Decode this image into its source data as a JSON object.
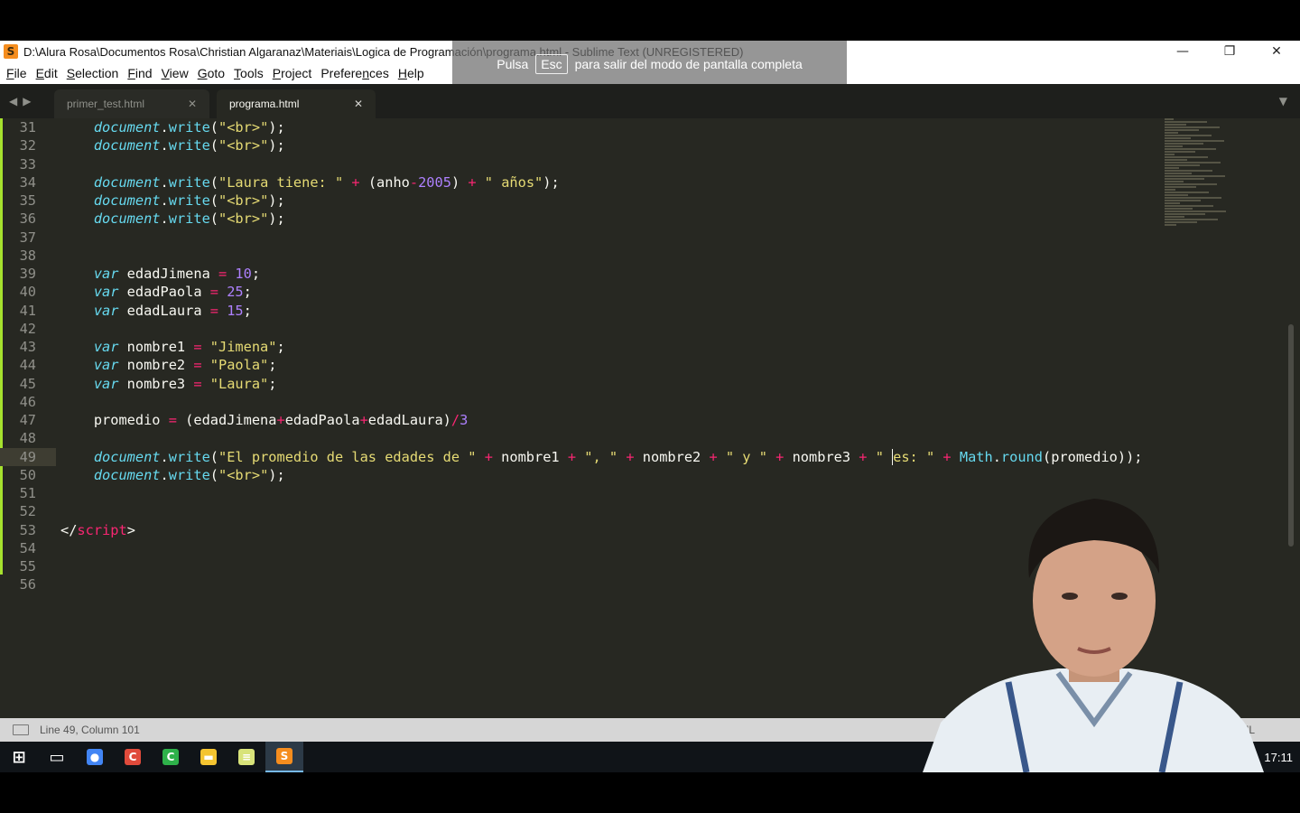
{
  "window": {
    "title": "D:\\Alura Rosa\\Documentos Rosa\\Christian Algaranaz\\Materiais\\Logica de Programación\\programa.html - Sublime Text (UNREGISTERED)",
    "minimize": "—",
    "maximize": "❐",
    "close": "✕"
  },
  "menu": [
    {
      "u": "F",
      "rest": "ile"
    },
    {
      "u": "E",
      "rest": "dit"
    },
    {
      "u": "S",
      "rest": "election"
    },
    {
      "u": "F",
      "rest": "ind",
      "pre": ""
    },
    {
      "u": "V",
      "rest": "iew"
    },
    {
      "u": "G",
      "rest": "oto"
    },
    {
      "u": "T",
      "rest": "ools"
    },
    {
      "u": "P",
      "rest": "roject"
    },
    {
      "pre": "Prefere",
      "u": "n",
      "rest": "ces"
    },
    {
      "u": "H",
      "rest": "elp"
    }
  ],
  "fullscreen_hint": {
    "before": "Pulsa",
    "key": "Esc",
    "after": "para salir del modo de pantalla completa"
  },
  "tabs": {
    "inactive": "primer_test.html",
    "active": "programa.html",
    "close": "✕",
    "dropdown": "▼",
    "nav_left": "◀",
    "nav_right": "▶"
  },
  "editor": {
    "current_line": 49,
    "lines": [
      {
        "n": "31",
        "tokens": [
          [
            "kw",
            "    document"
          ],
          [
            "",
            "."
          ],
          [
            "fn",
            "write"
          ],
          [
            "",
            "("
          ],
          [
            "str",
            "\"<br>\""
          ],
          [
            "",
            ");"
          ]
        ]
      },
      {
        "n": "32",
        "tokens": [
          [
            "kw",
            "    document"
          ],
          [
            "",
            "."
          ],
          [
            "fn",
            "write"
          ],
          [
            "",
            "("
          ],
          [
            "str",
            "\"<br>\""
          ],
          [
            "",
            ");"
          ]
        ]
      },
      {
        "n": "33",
        "tokens": []
      },
      {
        "n": "34",
        "tokens": [
          [
            "kw",
            "    document"
          ],
          [
            "",
            "."
          ],
          [
            "fn",
            "write"
          ],
          [
            "",
            "("
          ],
          [
            "str",
            "\"Laura tiene: \""
          ],
          [
            "",
            " "
          ],
          [
            "op",
            "+"
          ],
          [
            "",
            " (anho"
          ],
          [
            "op",
            "-"
          ],
          [
            "num",
            "2005"
          ],
          [
            "",
            ") "
          ],
          [
            "op",
            "+"
          ],
          [
            "",
            " "
          ],
          [
            "str",
            "\" años\""
          ],
          [
            "",
            ");"
          ]
        ]
      },
      {
        "n": "35",
        "tokens": [
          [
            "kw",
            "    document"
          ],
          [
            "",
            "."
          ],
          [
            "fn",
            "write"
          ],
          [
            "",
            "("
          ],
          [
            "str",
            "\"<br>\""
          ],
          [
            "",
            ");"
          ]
        ]
      },
      {
        "n": "36",
        "tokens": [
          [
            "kw",
            "    document"
          ],
          [
            "",
            "."
          ],
          [
            "fn",
            "write"
          ],
          [
            "",
            "("
          ],
          [
            "str",
            "\"<br>\""
          ],
          [
            "",
            ");"
          ]
        ]
      },
      {
        "n": "37",
        "tokens": []
      },
      {
        "n": "38",
        "tokens": []
      },
      {
        "n": "39",
        "tokens": [
          [
            "kw",
            "    var"
          ],
          [
            "",
            " edadJimena "
          ],
          [
            "op",
            "="
          ],
          [
            "",
            " "
          ],
          [
            "num",
            "10"
          ],
          [
            "",
            ";"
          ]
        ]
      },
      {
        "n": "40",
        "tokens": [
          [
            "kw",
            "    var"
          ],
          [
            "",
            " edadPaola "
          ],
          [
            "op",
            "="
          ],
          [
            "",
            " "
          ],
          [
            "num",
            "25"
          ],
          [
            "",
            ";"
          ]
        ]
      },
      {
        "n": "41",
        "tokens": [
          [
            "kw",
            "    var"
          ],
          [
            "",
            " edadLaura "
          ],
          [
            "op",
            "="
          ],
          [
            "",
            " "
          ],
          [
            "num",
            "15"
          ],
          [
            "",
            ";"
          ]
        ]
      },
      {
        "n": "42",
        "tokens": []
      },
      {
        "n": "43",
        "tokens": [
          [
            "kw",
            "    var"
          ],
          [
            "",
            " nombre1 "
          ],
          [
            "op",
            "="
          ],
          [
            "",
            " "
          ],
          [
            "str",
            "\"Jimena\""
          ],
          [
            "",
            ";"
          ]
        ]
      },
      {
        "n": "44",
        "tokens": [
          [
            "kw",
            "    var"
          ],
          [
            "",
            " nombre2 "
          ],
          [
            "op",
            "="
          ],
          [
            "",
            " "
          ],
          [
            "str",
            "\"Paola\""
          ],
          [
            "",
            ";"
          ]
        ]
      },
      {
        "n": "45",
        "tokens": [
          [
            "kw",
            "    var"
          ],
          [
            "",
            " nombre3 "
          ],
          [
            "op",
            "="
          ],
          [
            "",
            " "
          ],
          [
            "str",
            "\"Laura\""
          ],
          [
            "",
            ";"
          ]
        ]
      },
      {
        "n": "46",
        "tokens": []
      },
      {
        "n": "47",
        "tokens": [
          [
            "",
            "    promedio "
          ],
          [
            "op",
            "="
          ],
          [
            "",
            " (edadJimena"
          ],
          [
            "op",
            "+"
          ],
          [
            "",
            "edadPaola"
          ],
          [
            "op",
            "+"
          ],
          [
            "",
            "edadLaura)"
          ],
          [
            "op",
            "/"
          ],
          [
            "num",
            "3"
          ]
        ]
      },
      {
        "n": "48",
        "tokens": []
      },
      {
        "n": "49",
        "tokens": [
          [
            "kw",
            "    document"
          ],
          [
            "",
            "."
          ],
          [
            "fn",
            "write"
          ],
          [
            "",
            "("
          ],
          [
            "str",
            "\"El promedio de las edades de \""
          ],
          [
            "",
            " "
          ],
          [
            "op",
            "+"
          ],
          [
            "",
            " nombre1 "
          ],
          [
            "op",
            "+"
          ],
          [
            "",
            " "
          ],
          [
            "str",
            "\", \""
          ],
          [
            "",
            " "
          ],
          [
            "op",
            "+"
          ],
          [
            "",
            " nombre2 "
          ],
          [
            "op",
            "+"
          ],
          [
            "",
            " "
          ],
          [
            "str",
            "\" y \""
          ],
          [
            "",
            " "
          ],
          [
            "op",
            "+"
          ],
          [
            "",
            " nombre3 "
          ],
          [
            "op",
            "+"
          ],
          [
            "",
            " "
          ],
          [
            "str",
            "\" "
          ],
          [
            "cursor",
            ""
          ],
          [
            "str",
            "es: \""
          ],
          [
            "",
            " "
          ],
          [
            "op",
            "+"
          ],
          [
            "",
            " "
          ],
          [
            "fn",
            "Math"
          ],
          [
            "",
            "."
          ],
          [
            "fn",
            "round"
          ],
          [
            "",
            "(promedio));"
          ]
        ]
      },
      {
        "n": "50",
        "tokens": [
          [
            "kw",
            "    document"
          ],
          [
            "",
            "."
          ],
          [
            "fn",
            "write"
          ],
          [
            "",
            "("
          ],
          [
            "str",
            "\"<br>\""
          ],
          [
            "",
            ");"
          ]
        ]
      },
      {
        "n": "51",
        "tokens": []
      },
      {
        "n": "52",
        "tokens": []
      },
      {
        "n": "53",
        "tokens": [
          [
            "",
            "</"
          ],
          [
            "tag",
            "script"
          ],
          [
            "",
            ">"
          ]
        ]
      },
      {
        "n": "54",
        "tokens": []
      },
      {
        "n": "55",
        "tokens": []
      },
      {
        "n": "56",
        "tokens": []
      }
    ]
  },
  "status": {
    "position": "Line 49, Column 101",
    "syntax": "ML"
  },
  "taskbar": {
    "items": [
      {
        "name": "start",
        "icon": "windows-start-icon",
        "color": "#ffffff"
      },
      {
        "name": "task-view",
        "icon": "task-view-icon",
        "color": "#ffffff"
      },
      {
        "name": "chrome",
        "icon": "chrome-icon",
        "color": "#4285f4"
      },
      {
        "name": "app-red",
        "icon": "red-c-app-icon",
        "color": "#e04a3b"
      },
      {
        "name": "app-green",
        "icon": "green-c-app-icon",
        "color": "#2eb14a"
      },
      {
        "name": "explorer",
        "icon": "folder-icon",
        "color": "#f4c430"
      },
      {
        "name": "notepad",
        "icon": "notepad-icon",
        "color": "#d8e37a"
      },
      {
        "name": "sublime",
        "icon": "sublime-icon",
        "color": "#f58d1e"
      }
    ],
    "clock": "17:11"
  },
  "theme": {
    "background": "#272822",
    "keyword": "#66d9ef",
    "string": "#e6db74",
    "number": "#ae81ff",
    "operator": "#f92672"
  }
}
